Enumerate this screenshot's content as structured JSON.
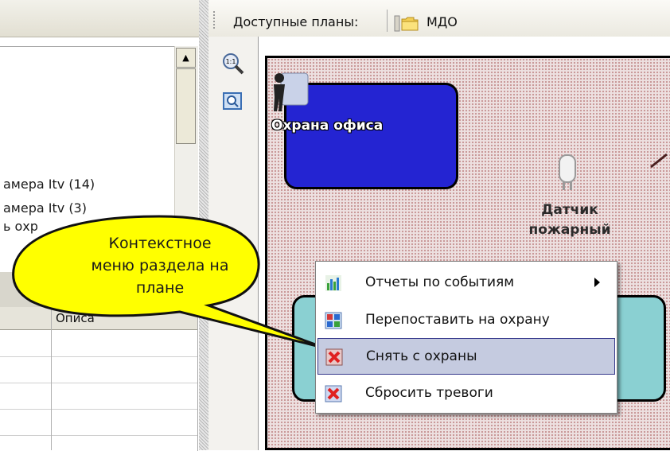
{
  "plan_toolbar": {
    "available_plans_label": "Доступные планы:",
    "current_plan": "МДО"
  },
  "object_tree": {
    "items": [
      "амера Itv (14)",
      "амера Itv (3)",
      "ь охр"
    ]
  },
  "event_table": {
    "columns": [
      "",
      "Описа"
    ]
  },
  "plan": {
    "zones": [
      {
        "label": "Охрана офиса",
        "color": "#2424d2"
      },
      {
        "label": "",
        "color": "#8ad0d2"
      }
    ],
    "sensor_label": "Датчик\nпожарный"
  },
  "callout": {
    "text": "Контекстное\nменю раздела на\nплане"
  },
  "context_menu": {
    "items": [
      {
        "label": "Отчеты по событиям",
        "icon": "bar-chart-icon",
        "has_submenu": true
      },
      {
        "label": "Перепоставить на охрану",
        "icon": "rearm-icon"
      },
      {
        "label": "Снять с охраны",
        "icon": "disarm-icon",
        "selected": true
      },
      {
        "label": "Сбросить тревоги",
        "icon": "reset-alarm-icon"
      }
    ]
  },
  "colors": {
    "menu_highlight": "#c5cbe0",
    "callout_fill": "#ffff00"
  }
}
